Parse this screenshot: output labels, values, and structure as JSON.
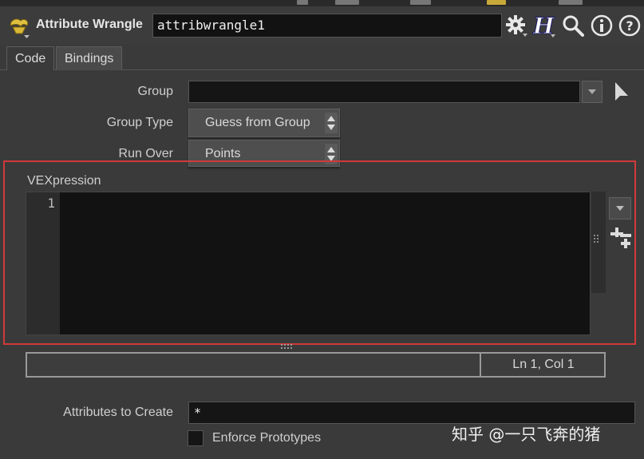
{
  "header": {
    "node_type": "Attribute Wrangle",
    "node_name": "attribwrangle1",
    "icons": [
      "gear-icon",
      "help-h-icon",
      "search-icon",
      "info-icon",
      "help-question-icon"
    ]
  },
  "tabs": [
    {
      "label": "Code",
      "active": true
    },
    {
      "label": "Bindings",
      "active": false
    }
  ],
  "params": {
    "group_label": "Group",
    "group_value": "",
    "group_type_label": "Group Type",
    "group_type_value": "Guess from Group",
    "run_over_label": "Run Over",
    "run_over_value": "Points",
    "vex_label": "VEXpression",
    "vex_line_number": "1",
    "vex_code": ""
  },
  "status": {
    "cursor_position": "Ln 1, Col 1"
  },
  "attributes": {
    "create_label": "Attributes to Create",
    "create_value": "*",
    "enforce_label": "Enforce Prototypes",
    "enforce_checked": false
  },
  "watermark": "知乎 @一只飞奔的猪",
  "colors": {
    "background": "#3a3a3a",
    "field": "#151515",
    "highlight_box": "#d03a3a"
  }
}
